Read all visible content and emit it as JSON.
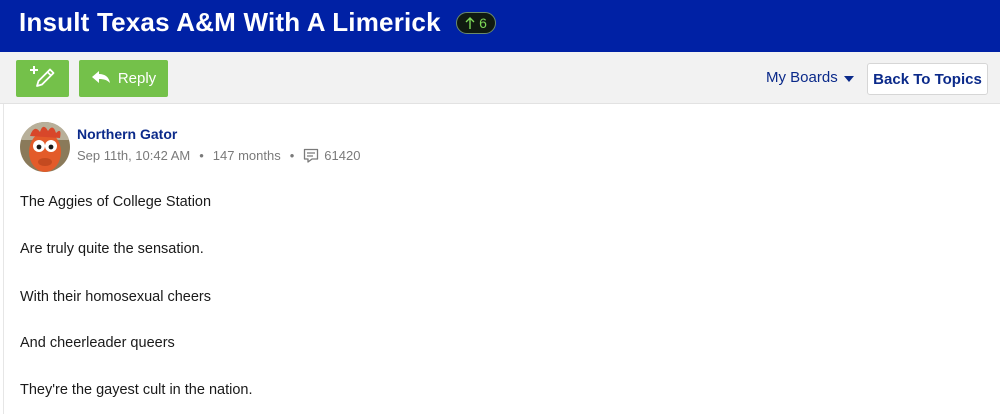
{
  "thread": {
    "title": "Insult Texas A&M With A Limerick",
    "vote_count": "6"
  },
  "toolbar": {
    "reply_label": "Reply",
    "my_boards_label": "My Boards",
    "back_label": "Back To Topics"
  },
  "post": {
    "author": "Northern Gator",
    "date": "Sep 11th, 10:42 AM",
    "member_age": "147 months",
    "post_count": "61420",
    "lines": [
      "The Aggies of College Station",
      "Are truly quite the sensation.",
      "With their homosexual cheers",
      "And cheerleader queers",
      "They're the gayest cult in the nation."
    ]
  },
  "colors": {
    "header_bg": "#0021a5",
    "button_green": "#74c14a",
    "link_blue": "#0b2a8a"
  },
  "icons": {
    "new_post": "pencil-plus-icon",
    "reply": "reply-arrow-icon",
    "dropdown": "caret-down-icon",
    "comment": "comment-icon",
    "upvote": "up-arrow-icon"
  }
}
